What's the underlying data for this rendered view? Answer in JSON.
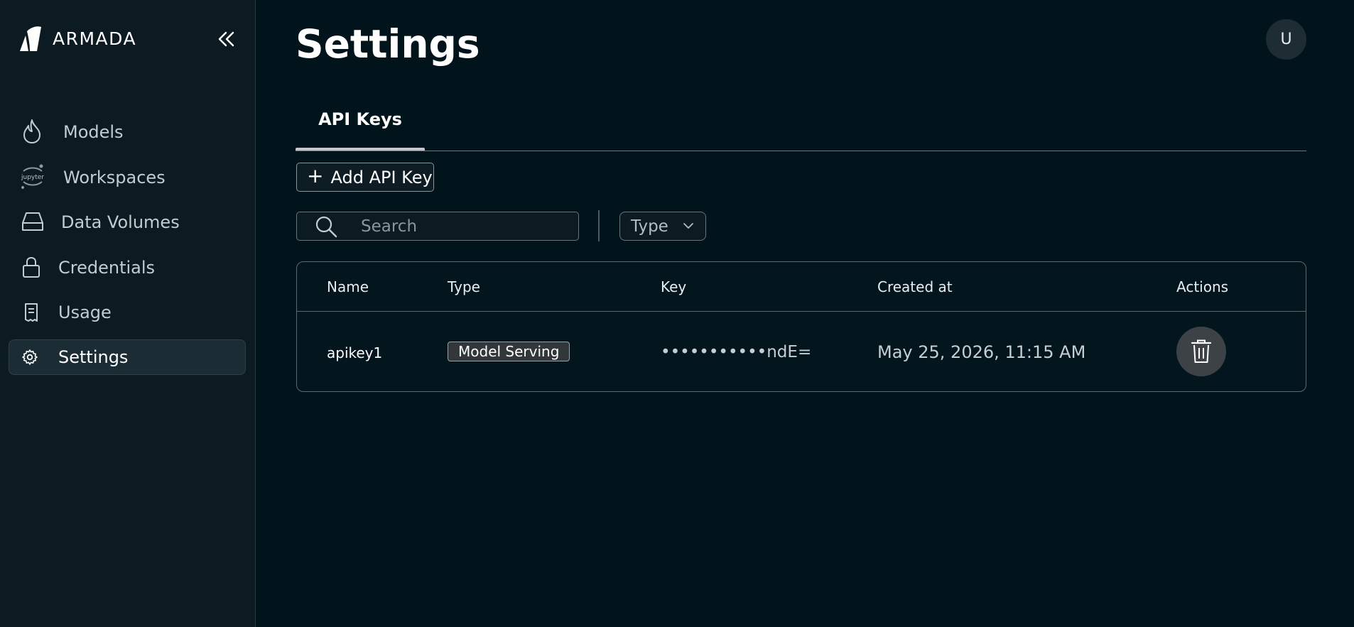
{
  "app": {
    "brand": "ARMADA"
  },
  "sidebar": {
    "collapse_icon": "double-chevron-left-icon",
    "items": [
      {
        "label": "Models",
        "icon": "flame-icon",
        "active": false
      },
      {
        "label": "Workspaces",
        "icon": "jupyter-icon",
        "icon_text": "jupyter",
        "active": false
      },
      {
        "label": "Data Volumes",
        "icon": "drive-icon",
        "active": false
      },
      {
        "label": "Credentials",
        "icon": "lock-icon",
        "active": false
      },
      {
        "label": "Usage",
        "icon": "receipt-icon",
        "active": false
      },
      {
        "label": "Settings",
        "icon": "gear-icon",
        "active": true
      }
    ]
  },
  "header": {
    "title": "Settings",
    "avatar_initial": "U"
  },
  "tabs": [
    {
      "label": "API Keys",
      "active": true
    }
  ],
  "toolbar": {
    "add_label": "Add API Key",
    "search_placeholder": "Search",
    "type_filter_label": "Type"
  },
  "table": {
    "columns": [
      "Name",
      "Type",
      "Key",
      "Created at",
      "Actions"
    ],
    "rows": [
      {
        "name": "apikey1",
        "type": "Model Serving",
        "key": "•••••••••••ndE=",
        "created_at": "May 25, 2026, 11:15 AM",
        "action_icon": "trash-icon"
      }
    ]
  },
  "colors": {
    "background": "#02141b",
    "sidebar": "#0c1a21",
    "active_item": "#1c2c34",
    "badge": "#31373b",
    "delete_button": "#3c4246"
  }
}
